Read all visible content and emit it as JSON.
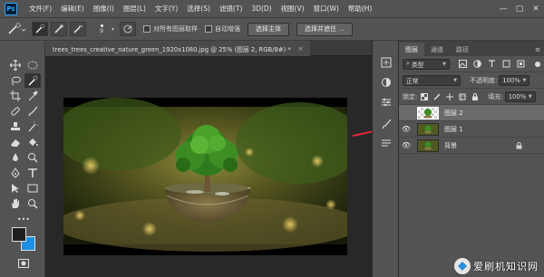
{
  "app": {
    "logo_text": "Ps"
  },
  "menu": [
    "文件(F)",
    "编辑(E)",
    "图像(I)",
    "图层(L)",
    "文字(Y)",
    "选择(S)",
    "滤镜(T)",
    "3D(D)",
    "视图(V)",
    "窗口(W)",
    "帮助(H)"
  ],
  "window_controls": {
    "minimize": "—",
    "maximize": "▢",
    "close": "✕"
  },
  "options_bar": {
    "brush_size": "9",
    "sample_all_layers": "对所有图层取样",
    "auto_enhance": "自动增强",
    "select_subject": "选择主体",
    "select_and_mask": "选择并遮住 ..."
  },
  "document": {
    "tab_title": "trees_trees_creative_nature_green_1920x1080.jpg @ 25% (图层 2, RGB/8#) *",
    "tab_close": "×"
  },
  "colors": {
    "foreground": "#1f1f1f",
    "background": "#1c8fe3",
    "accent": "#31a8ff",
    "arrow": "#e0283a"
  },
  "layers_panel": {
    "tabs": [
      "图层",
      "通道",
      "路径"
    ],
    "filter_kind": "类型",
    "blend_mode": "正常",
    "opacity_label": "不透明度:",
    "opacity_value": "100%",
    "lock_label": "锁定:",
    "fill_label": "填充:",
    "fill_value": "100%",
    "layers": [
      {
        "name": "图层 2",
        "selected": true,
        "visible": false
      },
      {
        "name": "图层 1",
        "selected": false,
        "visible": true
      },
      {
        "name": "背景",
        "selected": false,
        "visible": true,
        "locked": true
      }
    ]
  },
  "watermark": {
    "text": "爱刷机知识网"
  }
}
